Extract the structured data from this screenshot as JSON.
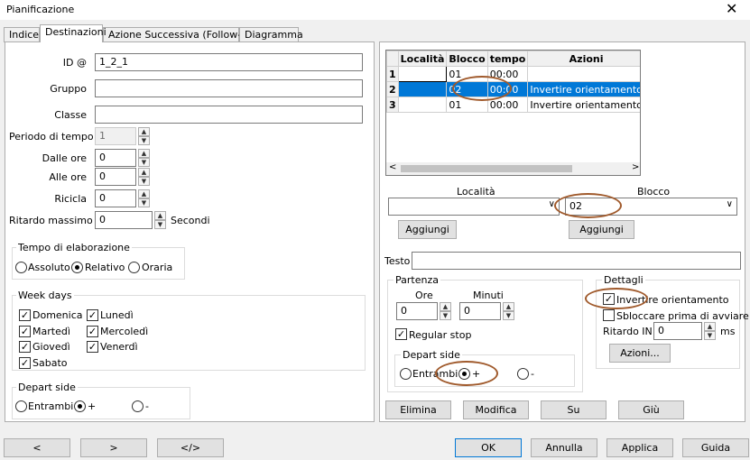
{
  "window": {
    "title": "Pianificazione",
    "close": "✕"
  },
  "tabs": [
    "Indice",
    "Destinazioni",
    "Azione Successiva (Follow-up)",
    "Diagramma"
  ],
  "left": {
    "id_label": "ID @",
    "id_value": "1_2_1",
    "gruppo_label": "Gruppo",
    "gruppo_value": "",
    "classe_label": "Classe",
    "classe_value": "",
    "periodo_label": "Periodo di tempo",
    "periodo_value": "1",
    "dalle_label": "Dalle ore",
    "dalle_value": "0",
    "alle_label": "Alle ore",
    "alle_value": "0",
    "ricicla_label": "Ricicla",
    "ricicla_value": "0",
    "ritardo_label": "Ritardo massimo",
    "ritardo_value": "0",
    "ritardo_unit": "Secondi",
    "elab": {
      "title": "Tempo di elaborazione",
      "options": [
        "Assoluto",
        "Relativo",
        "Oraria"
      ],
      "selected": 1
    },
    "week": {
      "title": "Week days",
      "days": [
        "Domenica",
        "Lunedì",
        "Martedì",
        "Mercoledì",
        "Giovedì",
        "Venerdì",
        "Sabato"
      ]
    },
    "depart": {
      "title": "Depart side",
      "options": [
        "Entrambi",
        "+",
        "-"
      ],
      "selected": 1
    }
  },
  "right": {
    "table": {
      "headers": [
        "Località",
        "Blocco",
        "tempo",
        "Azioni"
      ],
      "rows": [
        {
          "n": "1",
          "loc": "",
          "blocco": "01",
          "tempo": "00:00",
          "azioni": ""
        },
        {
          "n": "2",
          "loc": "",
          "blocco": "02",
          "tempo": "00:00",
          "azioni": "Invertire orientamento"
        },
        {
          "n": "3",
          "loc": "",
          "blocco": "01",
          "tempo": "00:00",
          "azioni": "Invertire orientamento"
        }
      ],
      "selected_row": 1
    },
    "localita_label": "Località",
    "localita_value": "",
    "blocco_label": "Blocco",
    "blocco_value": "02",
    "aggiungi": "Aggiungi",
    "testo_label": "Testo",
    "testo_value": "",
    "partenza": {
      "title": "Partenza",
      "ore_label": "Ore",
      "ore_value": "0",
      "minuti_label": "Minuti",
      "minuti_value": "0",
      "regular_stop": "Regular stop"
    },
    "depart": {
      "title": "Depart side",
      "options": [
        "Entrambi",
        "+",
        "-"
      ],
      "selected": 1
    },
    "dettagli": {
      "title": "Dettagli",
      "invertire": "Invertire orientamento",
      "sbloccare": "Sbloccare prima di avviare",
      "ritardo_label": "Ritardo IN",
      "ritardo_value": "0",
      "ritardo_unit": "ms",
      "azioni": "Azioni..."
    },
    "buttons": {
      "elimina": "Elimina",
      "modifica": "Modifica",
      "su": "Su",
      "giu": "Giù"
    }
  },
  "bottom": {
    "prev": "<",
    "next": ">",
    "code": "</>",
    "ok": "OK",
    "annulla": "Annulla",
    "applica": "Applica",
    "guida": "Guida"
  },
  "colors": {
    "selection": "#0078d7",
    "annotation": "#a05a2c"
  }
}
